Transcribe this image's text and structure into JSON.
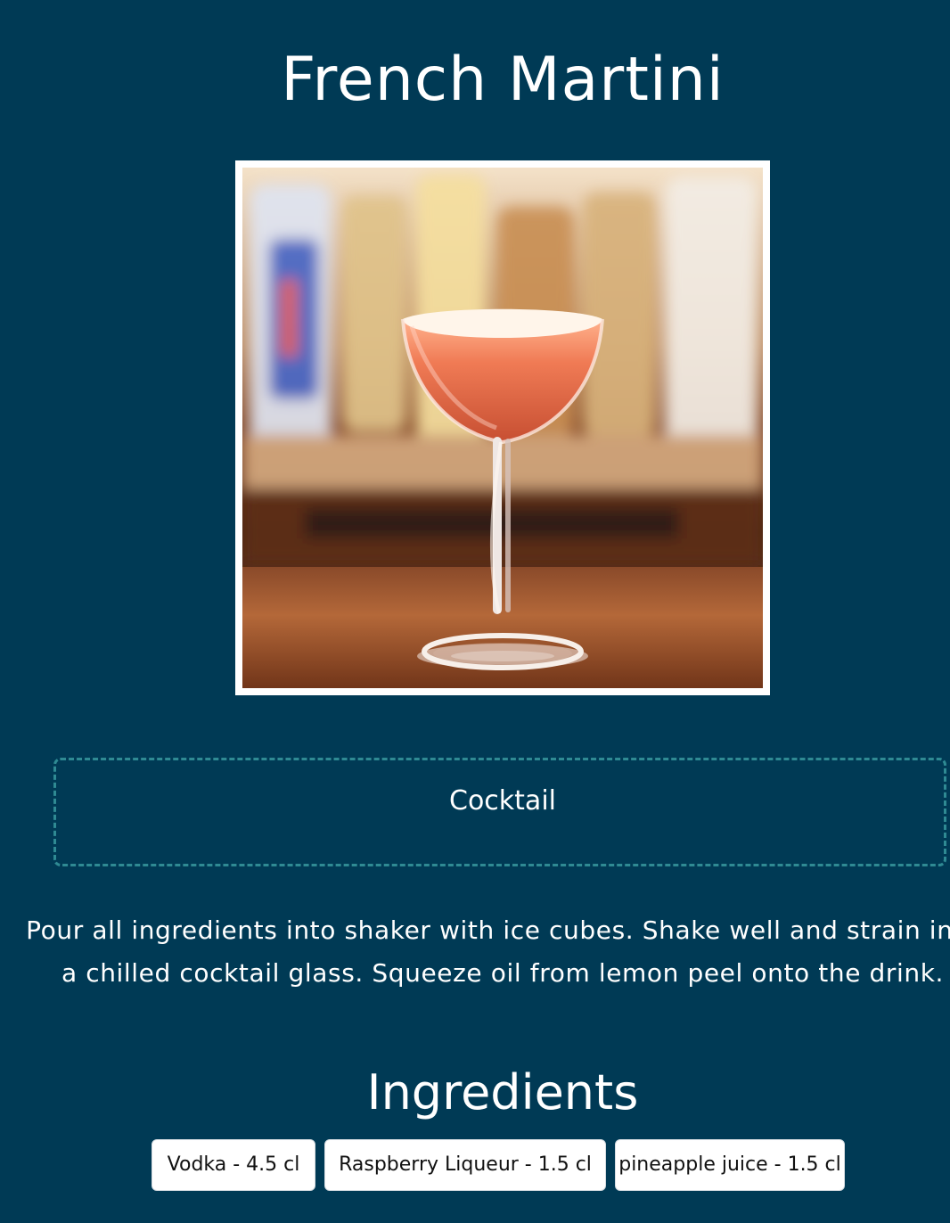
{
  "drink": {
    "name": "French Martini",
    "category": "Cocktail",
    "instructions": "Pour all ingredients into shaker with ice cubes. Shake well and strain into a chilled cocktail glass. Squeeze oil from lemon peel onto the drink."
  },
  "ingredients": {
    "heading": "Ingredients",
    "items": [
      {
        "label": "Vodka - 4.5 cl"
      },
      {
        "label": "Raspberry Liqueur - 1.5 cl"
      },
      {
        "label": "pineapple juice - 1.5 cl"
      }
    ]
  },
  "colors": {
    "background": "#003a55",
    "text": "#ffffff",
    "category_border": "#2f8a93",
    "chip_background": "#ffffff",
    "chip_text": "#111111"
  }
}
